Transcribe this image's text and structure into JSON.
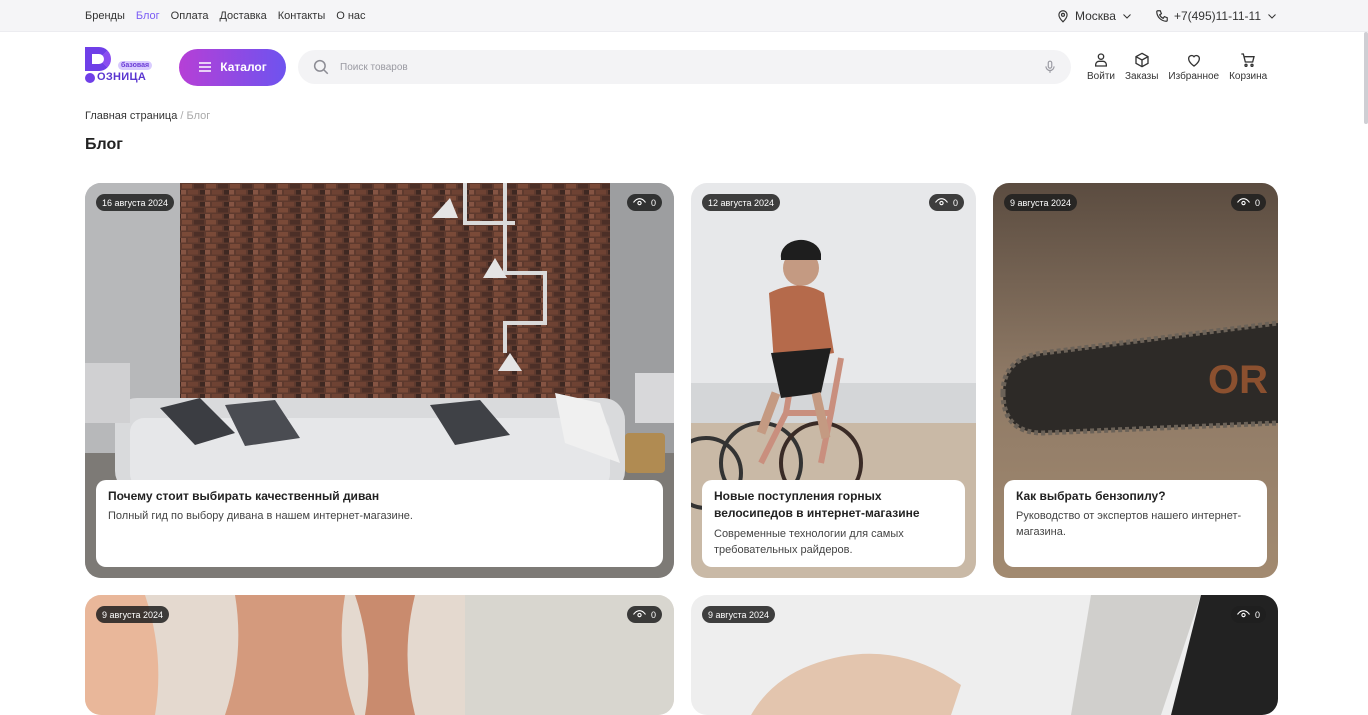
{
  "topbar": {
    "nav": [
      "Бренды",
      "Блог",
      "Оплата",
      "Доставка",
      "Контакты",
      "О нас"
    ],
    "active_index": 1,
    "city": "Москва",
    "phone": "+7(495)11-11-11"
  },
  "header": {
    "logo_badge": "базовая",
    "logo_text": "ОЗНИЦА",
    "catalog_label": "Каталог",
    "search_placeholder": "Поиск товаров",
    "actions": [
      {
        "label": "Войти",
        "icon": "user-icon"
      },
      {
        "label": "Заказы",
        "icon": "box-icon"
      },
      {
        "label": "Избранное",
        "icon": "heart-icon"
      },
      {
        "label": "Корзина",
        "icon": "cart-icon"
      }
    ]
  },
  "breadcrumb": {
    "home": "Главная страница",
    "current": "Блог"
  },
  "page_title": "Блог",
  "posts": [
    {
      "date": "16 августа 2024",
      "views": "0",
      "title": "Почему стоит выбирать качественный диван",
      "excerpt": "Полный гид по выбору дивана в нашем интернет-магазине."
    },
    {
      "date": "12 августа 2024",
      "views": "0",
      "title": "Новые поступления горных велосипедов в интернет-магазине",
      "excerpt": "Современные технологии для самых требовательных райдеров."
    },
    {
      "date": "9 августа 2024",
      "views": "0",
      "title": "Как выбрать бензопилу?",
      "excerpt": "Руководство от экспертов нашего интернет-магазина."
    },
    {
      "date": "9 августа 2024",
      "views": "0",
      "title": "",
      "excerpt": ""
    },
    {
      "date": "9 августа 2024",
      "views": "0",
      "title": "",
      "excerpt": ""
    }
  ],
  "colors": {
    "accent": "#7b5cf5",
    "catalog_gradient_start": "#b63fd6",
    "catalog_gradient_end": "#6e53ef"
  }
}
